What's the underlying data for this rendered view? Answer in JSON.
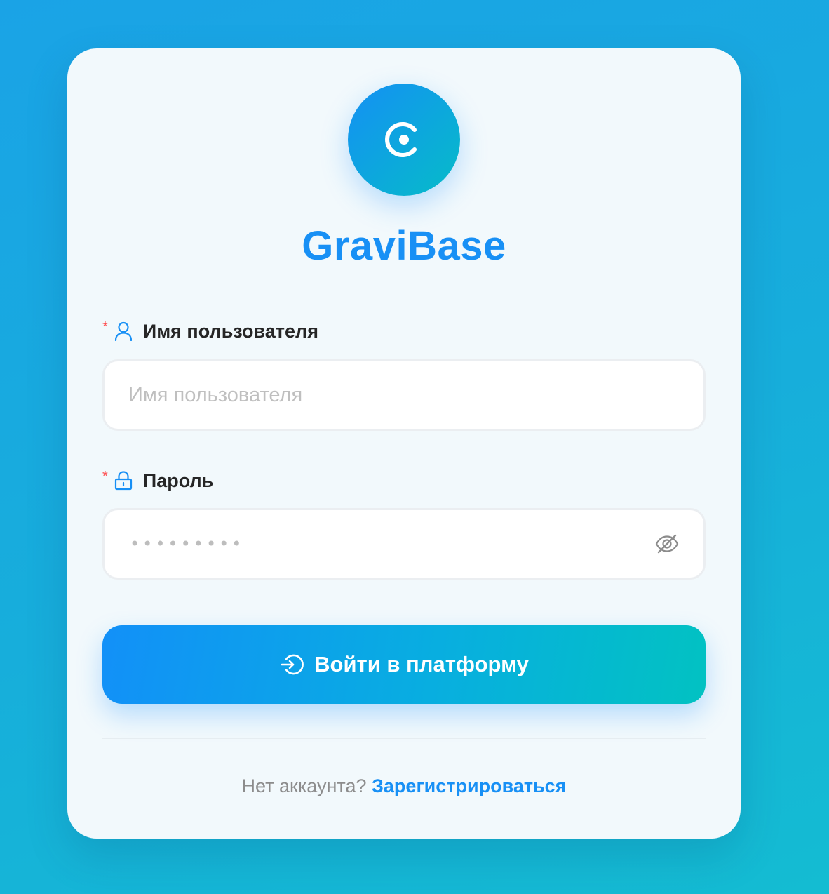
{
  "brand": {
    "name": "GraviBase",
    "logo_icon": "gravibase-logo-icon"
  },
  "form": {
    "username": {
      "required_mark": "*",
      "icon": "user-icon",
      "label": "Имя пользователя",
      "placeholder": "Имя пользователя",
      "value": ""
    },
    "password": {
      "required_mark": "*",
      "icon": "lock-icon",
      "label": "Пароль",
      "masked_value": "•••••••••",
      "visibility_icon": "eye-off-icon"
    },
    "submit": {
      "icon": "login-icon",
      "label": "Войти в платформу"
    }
  },
  "footer": {
    "prompt": "Нет аккаунта?",
    "register_link": "Зарегистрироваться"
  },
  "colors": {
    "accent": "#1890f5",
    "accent_end": "#02c2c2",
    "required": "#ff4d4f",
    "background": "#17aedb"
  }
}
